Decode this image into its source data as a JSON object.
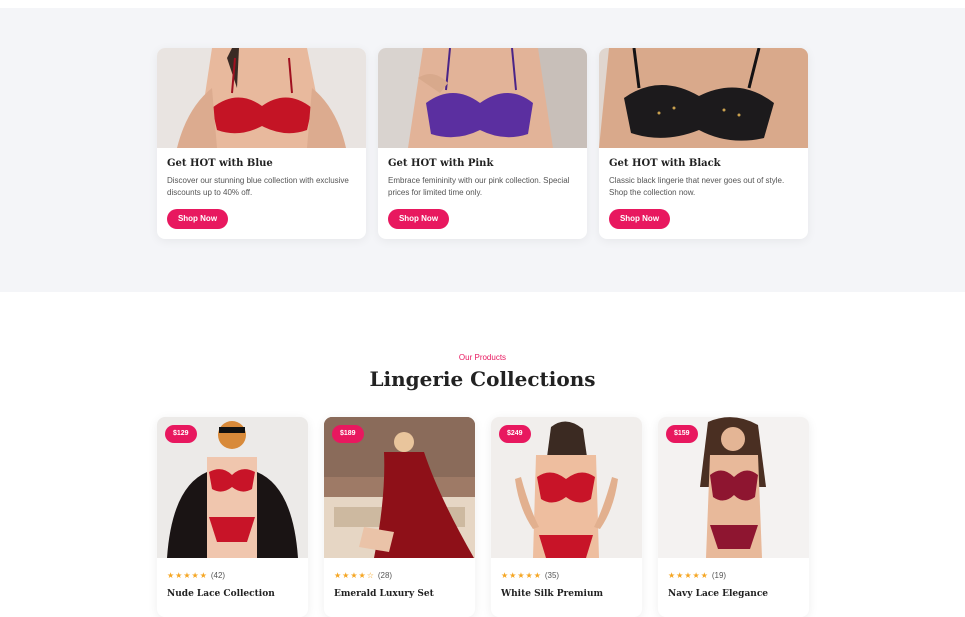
{
  "promos": [
    {
      "title": "Get HOT with Blue",
      "description": "Discover our stunning blue collection with exclusive discounts up to 40% off.",
      "button": "Shop Now"
    },
    {
      "title": "Get HOT with Pink",
      "description": "Embrace femininity with our pink collection. Special prices for limited time only.",
      "button": "Shop Now"
    },
    {
      "title": "Get HOT with Black",
      "description": "Classic black lingerie that never goes out of style. Shop the collection now.",
      "button": "Shop Now"
    }
  ],
  "products_section": {
    "eyebrow": "Our Products",
    "title": "Lingerie Collections"
  },
  "products": [
    {
      "price": "$129",
      "stars": "★★★★★",
      "reviews": "(42)",
      "name": "Nude Lace Collection"
    },
    {
      "price": "$189",
      "stars": "★★★★☆",
      "reviews": "(28)",
      "name": "Emerald Luxury Set"
    },
    {
      "price": "$249",
      "stars": "★★★★★",
      "reviews": "(35)",
      "name": "White Silk Premium"
    },
    {
      "price": "$159",
      "stars": "★★★★★",
      "reviews": "(19)",
      "name": "Navy Lace Elegance"
    }
  ],
  "colors": {
    "accent": "#e8185f",
    "star": "#f5a623",
    "section_bg": "#f4f5f8"
  }
}
